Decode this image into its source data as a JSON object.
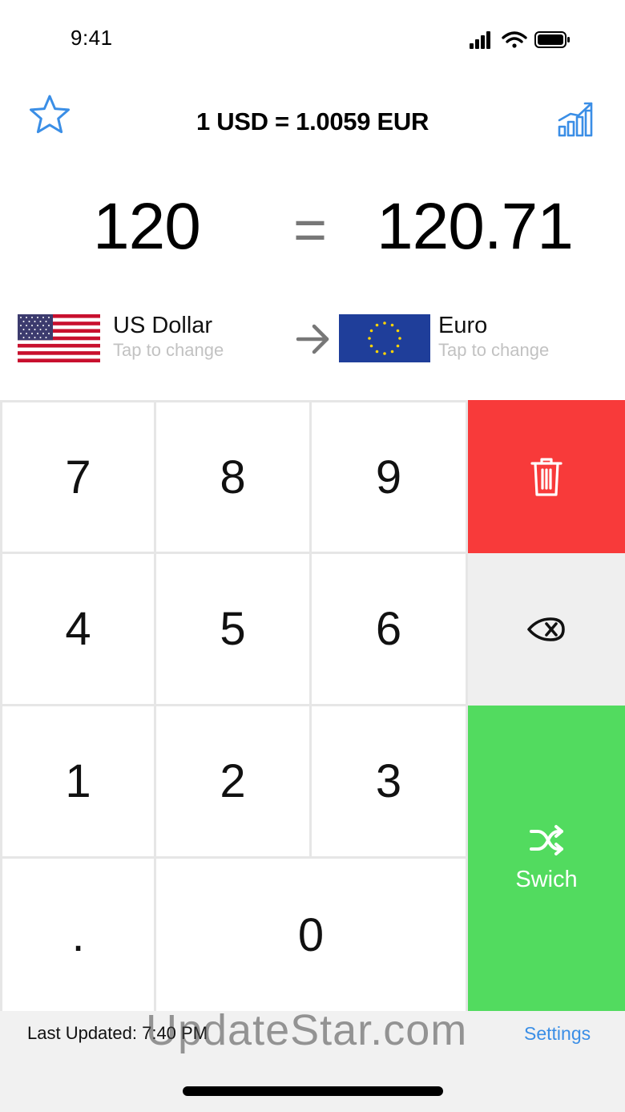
{
  "status_bar": {
    "time": "9:41"
  },
  "header": {
    "rate": "1 USD = 1.0059 EUR"
  },
  "conversion": {
    "from_amount": "120",
    "equals": "=",
    "to_amount": "120.71"
  },
  "from_currency": {
    "name": "US Dollar",
    "hint": "Tap to change"
  },
  "to_currency": {
    "name": "Euro",
    "hint": "Tap to change"
  },
  "keypad": {
    "k7": "7",
    "k8": "8",
    "k9": "9",
    "k4": "4",
    "k5": "5",
    "k6": "6",
    "k1": "1",
    "k2": "2",
    "k3": "3",
    "kdot": ".",
    "k0": "0",
    "switch_label": "Swich"
  },
  "footer": {
    "last_updated": "Last Updated: 7:40 PM",
    "settings": "Settings",
    "watermark": "UpdateStar.com"
  },
  "colors": {
    "accent": "#3a8ee6",
    "clear_key": "#f83a3a",
    "switch_key": "#52db5f",
    "backspace_key": "#efefef"
  },
  "icons": {
    "favorite": "star-outline-icon",
    "chart": "bar-chart-trend-icon",
    "arrow": "arrow-right-icon",
    "clear": "trash-icon",
    "backspace": "backspace-icon",
    "switch": "shuffle-icon"
  }
}
